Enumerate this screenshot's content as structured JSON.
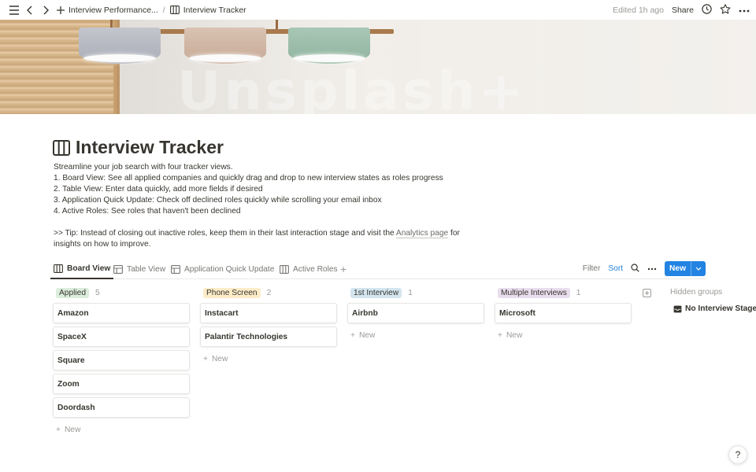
{
  "topbar": {
    "breadcrumb_parent": "Interview Performance...",
    "breadcrumb_sep": "/",
    "breadcrumb_current": "Interview Tracker",
    "edited": "Edited 1h ago",
    "share": "Share"
  },
  "cover": {
    "watermark": "Unsplash+"
  },
  "page": {
    "title": "Interview Tracker",
    "description": [
      "Streamline your job search with four tracker views.",
      "1. Board View: See all applied companies and quickly drag and drop to new interview states as roles progress",
      "2. Table View: Enter data quickly, add more fields if desired",
      "3. Application Quick Update: Check off declined roles quickly while scrolling your email inbox",
      "4. Active Roles: See roles that haven't been declined",
      ""
    ],
    "tip_prefix": ">> Tip: Instead of closing out inactive roles, keep them in their last interaction stage and visit the ",
    "tip_link": "Analytics page",
    "tip_suffix": " for",
    "tip_line2": "insights on how to improve."
  },
  "views": {
    "tabs": [
      "Board View",
      "Table View",
      "Application Quick Update",
      "Active Roles"
    ],
    "filter": "Filter",
    "sort": "Sort",
    "new": "New"
  },
  "board": {
    "new_label": "New",
    "columns": [
      {
        "name": "Applied",
        "count": "5",
        "color": "#dbeddb",
        "cards": [
          "Amazon",
          "SpaceX",
          "Square",
          "Zoom",
          "Doordash"
        ]
      },
      {
        "name": "Phone Screen",
        "count": "2",
        "color": "#fdecc8",
        "cards": [
          "Instacart",
          "Palantir Technologies"
        ]
      },
      {
        "name": "1st Interview",
        "count": "1",
        "color": "#d3e5ef",
        "cards": [
          "Airbnb"
        ]
      },
      {
        "name": "Multiple Interviews",
        "count": "1",
        "color": "#e8deee",
        "cards": [
          "Microsoft"
        ]
      }
    ],
    "hidden_groups": "Hidden groups",
    "hidden_item": "No Interview Stage"
  },
  "help": "?"
}
